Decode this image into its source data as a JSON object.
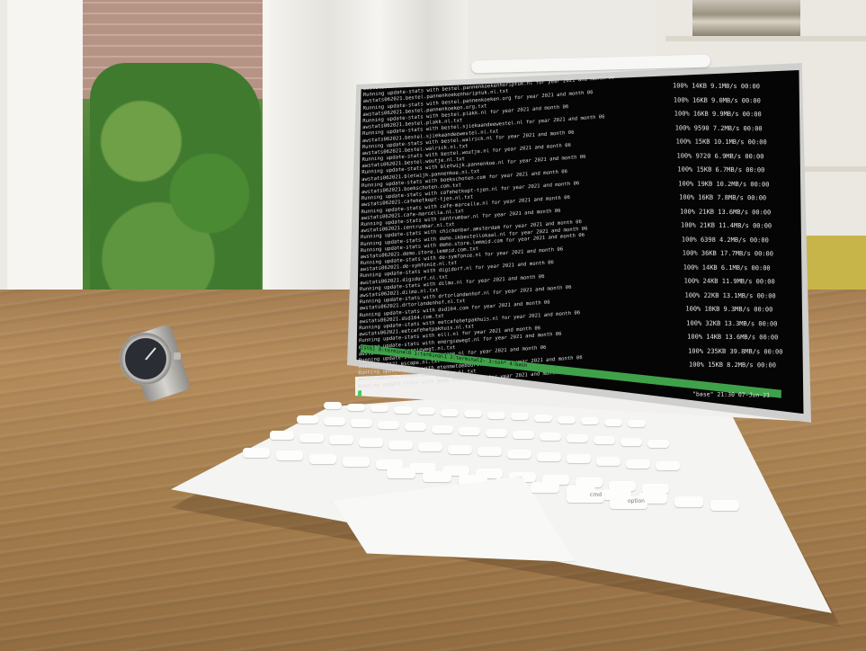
{
  "terminal": {
    "lines": [
      "awstats062021.bestel.pannenkoekenhuisheesch.nl.txt",
      "Running update-stats with bestel.pannenkoekenhoriptuk.nl for year 2021 and month 06",
      "awstats062021.bestel.pannenkoekenhoriptuk.nl.txt",
      "Running update-stats with bestel.pannenkoeken.org for year 2021 and month 06",
      "awstats062021.bestel.pannenkoeken.org.txt",
      "Running update-stats with bestel.plakk.nl for year 2021 and month 06",
      "awstats062021.bestel.plakk.nl.txt",
      "Running update-stats with bestel.sjiekaandeewestel.nl for year 2021 and month 06",
      "awstats062021.bestel.sjiekaandeewestel.nl.txt",
      "Running update-stats with bestel.walrick.nl for year 2021 and month 06",
      "awstats062021.bestel.walrick.nl.txt",
      "Running update-stats with bestel.woutje.nl for year 2021 and month 06",
      "awstats062021.bestel.woutje.nl.txt",
      "Running update-stats with bletwijk.pannenkoe.nl for year 2021 and month 06",
      "awstats062021.bletwijk.pannenkoe.nl.txt",
      "Running update-stats with boekschoten.com for year 2021 and month 06",
      "awstats062021.boekschoten.com.txt",
      "Running update-stats with cafehetkopt-tjen.nl for year 2021 and month 06",
      "awstats062021.cafehetkopt-tjen.nl.txt",
      "Running update-stats with cafe-marcella.nl for year 2021 and month 06",
      "awstats062021.cafe-marcella.nl.txt",
      "Running update-stats with centrumbar.nl for year 2021 and month 06",
      "awstats062021.centrumbar.nl.txt",
      "Running update-stats with chickenbar.amsterdam for year 2021 and month 06",
      "Running update-stats with demo.ikbestellokaal.nl for year 2021 and month 06",
      "Running update-stats with demo.store.lemmid.com for year 2021 and month 06",
      "awstats062021.demo.store.lemmid.com.txt",
      "Running update-stats with de-symfonie.nl for year 2021 and month 06",
      "awstats062021.de-symfonie.nl.txt",
      "Running update-stats with digidorf.nl for year 2021 and month 06",
      "awstats062021.digidorf.nl.txt",
      "Running update-stats with dilmo.nl for year 2021 and month 06",
      "awstats062021.dilmo.nl.txt",
      "Running update-stats with drtorlandenhof.nl for year 2021 and month 06",
      "awstats062021.drtorlandenhof.nl.txt",
      "Running update-stats with dsd164.com for year 2021 and month 06",
      "awstats062021.dsd164.com.txt",
      "Running update-stats with eetcafehetpakhuis.nl for year 2021 and month 06",
      "awstats062021.eetcafehetpakhuis.nl.txt",
      "Running update-stats with elll.nl for year 2021 and month 06",
      "Running update-stats with energiewegt.nl for year 2021 and month 06",
      "awstats062021.energiewegt.nl.txt",
      "Running update-stats with escape.nl for year 2021 and month 06",
      "awstats062021.escape.nl.txt",
      "Running update-stats with etenmetdebourvrouw.nl for year 2021 and month 06",
      "awstats062021.etenmetdebourvrouw.nl.txt",
      "Running update-stats with game.snakeST.com for year 2021 and month 06"
    ],
    "stats": [
      "100%   14KB   9.1MB/s   00:00",
      "100%   16KB   9.0MB/s   00:00",
      "100%   16KB   9.9MB/s   00:00",
      "100%  9590    7.2MB/s   00:00",
      "100%   15KB  10.1MB/s   00:00",
      "100%  9720    6.9MB/s   00:00",
      "100%   15KB   6.7MB/s   00:00",
      "100%   19KB  10.2MB/s   00:00",
      "100%   16KB   7.8MB/s   00:00",
      "100%   21KB  13.6MB/s   00:00",
      "100%   21KB  11.4MB/s   00:00",
      "100%  6398    4.2MB/s   00:00",
      "100%   36KB  17.7MB/s   00:00",
      "100%   14KB   6.1MB/s   00:00",
      "100%   24KB  11.9MB/s   00:00",
      "100%   22KB  13.1MB/s   00:00",
      "100%   18KB   9.3MB/s   00:00",
      "100%   32KB  13.3MB/s   00:00",
      "100%   14KB  13.6MB/s   00:00",
      "100%  235KB  39.8MB/s   00:00",
      "100%   15KB   8.2MB/s   00:00"
    ],
    "status_bar": "[stb] 0:terminal0  1:terminal1  2:terminal2- 3:ssh* 4:bash",
    "status_right": "\"base\" 21:30 07-Jun-21"
  },
  "keyboard": {
    "key_labels": [
      "cmd",
      "option"
    ]
  },
  "colors": {
    "terminal_bg": "#050505",
    "status_green": "#3fa24a",
    "table_wood": "#a67f52",
    "device_white": "#f4f4f2"
  }
}
